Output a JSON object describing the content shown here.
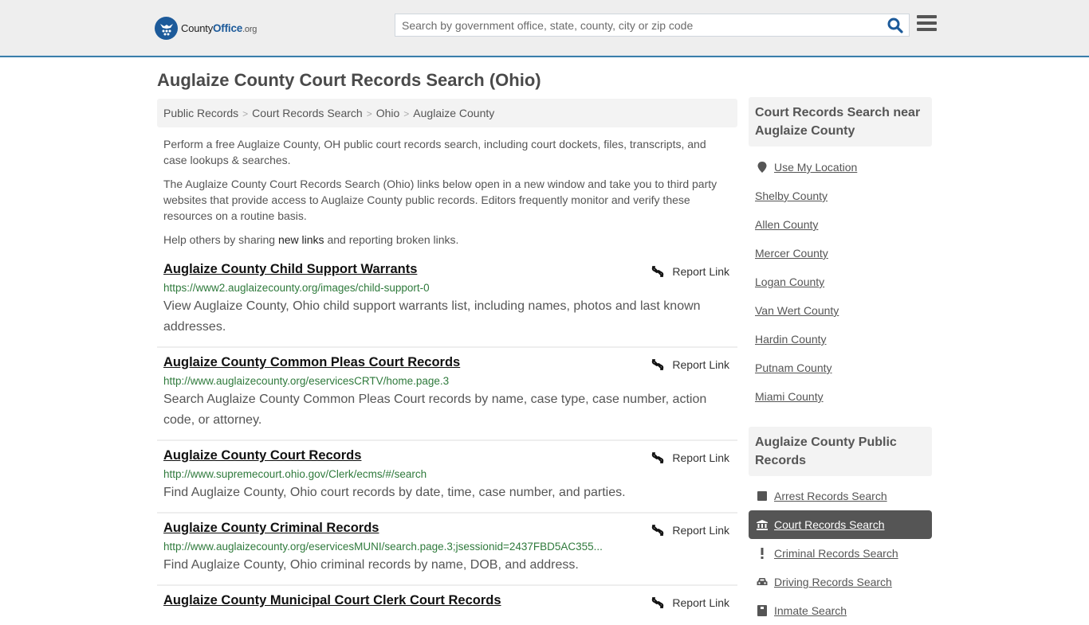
{
  "header": {
    "logo": {
      "name": "County",
      "name_bold": "Office",
      "tld": ".org",
      "icon": "eagle-stars-icon"
    },
    "search": {
      "placeholder": "Search by government office, state, county, city or zip code",
      "value": "",
      "icon": "search-icon"
    },
    "menu_icon": "hamburger-menu-icon",
    "accent": "#3a7eaa",
    "brand": "#1c5a9a"
  },
  "page": {
    "title": "Auglaize County Court Records Search (Ohio)"
  },
  "breadcrumb": [
    {
      "label": "Public Records"
    },
    {
      "label": "Court Records Search"
    },
    {
      "label": "Ohio"
    },
    {
      "label": "Auglaize County"
    }
  ],
  "intro": {
    "p1": "Perform a free Auglaize County, OH public court records search, including court dockets, files, transcripts, and case lookups & searches.",
    "p2": "The Auglaize County Court Records Search (Ohio) links below open in a new window and take you to third party websites that provide access to Auglaize County public records. Editors frequently monitor and verify these resources on a routine basis.",
    "p3_before": "Help others by sharing ",
    "p3_link": "new links",
    "p3_after": " and reporting broken links."
  },
  "report_label": "Report Link",
  "results": [
    {
      "title": "Auglaize County Child Support Warrants",
      "url": "https://www2.auglaizecounty.org/images/child-support-0",
      "desc": "View Auglaize County, Ohio child support warrants list, including names, photos and last known addresses."
    },
    {
      "title": "Auglaize County Common Pleas Court Records",
      "url": "http://www.auglaizecounty.org/eservicesCRTV/home.page.3",
      "desc": "Search Auglaize County Common Pleas Court records by name, case type, case number, action code, or attorney."
    },
    {
      "title": "Auglaize County Court Records",
      "url": "http://www.supremecourt.ohio.gov/Clerk/ecms/#/search",
      "desc": "Find Auglaize County, Ohio court records by date, time, case number, and parties."
    },
    {
      "title": "Auglaize County Criminal Records",
      "url": "http://www.auglaizecounty.org/eservicesMUNI/search.page.3;jsessionid=2437FBD5AC355...",
      "desc": "Find Auglaize County, Ohio criminal records by name, DOB, and address."
    },
    {
      "title": "Auglaize County Municipal Court Clerk Court Records",
      "url": "",
      "desc": ""
    }
  ],
  "sidebar": {
    "nearby_title": "Court Records Search near Auglaize County",
    "use_location": "Use My Location",
    "nearby": [
      "Shelby County",
      "Allen County",
      "Mercer County",
      "Logan County",
      "Van Wert County",
      "Hardin County",
      "Putnam County",
      "Miami County"
    ],
    "public_title": "Auglaize County Public Records",
    "public_links": [
      {
        "label": "Arrest Records Search",
        "icon": "square-icon",
        "active": false
      },
      {
        "label": "Court Records Search",
        "icon": "courthouse-icon",
        "active": true
      },
      {
        "label": "Criminal Records Search",
        "icon": "exclamation-icon",
        "active": false
      },
      {
        "label": "Driving Records Search",
        "icon": "car-icon",
        "active": false
      },
      {
        "label": "Inmate Search",
        "icon": "inmate-icon",
        "active": false
      }
    ]
  }
}
